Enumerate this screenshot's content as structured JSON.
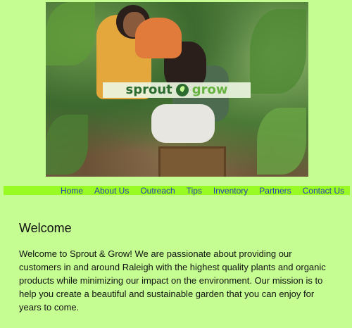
{
  "hero": {
    "logo_part_1": "sprout",
    "logo_part_2": "grow"
  },
  "nav": {
    "items": [
      {
        "label": "Home"
      },
      {
        "label": "About Us"
      },
      {
        "label": "Outreach"
      },
      {
        "label": "Tips"
      },
      {
        "label": "Inventory"
      },
      {
        "label": "Partners"
      },
      {
        "label": "Contact Us"
      }
    ]
  },
  "main": {
    "title": "Welcome",
    "body": "Welcome to Sprout & Grow! We are passionate about providing our customers in and around Raleigh with the highest quality plants and organic products while minimizing our impact on the environment. Our mission is to help you create a beautiful and sustainable garden that you can enjoy for years to come."
  },
  "colors": {
    "background": "#c5fd92",
    "nav_background": "#99fb24",
    "nav_text": "#2c3cba",
    "logo_dark": "#2c6b2f",
    "logo_light": "#67b341"
  }
}
